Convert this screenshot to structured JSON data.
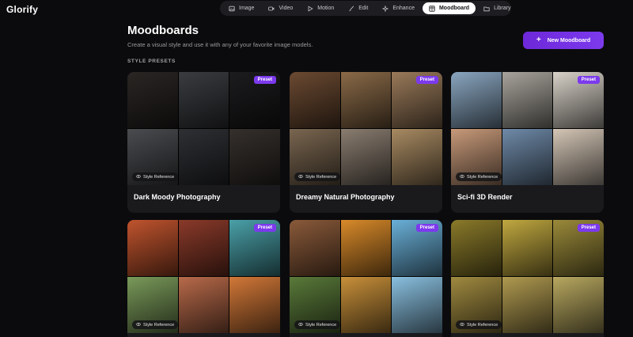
{
  "app": {
    "logo": "Glorify"
  },
  "nav": [
    {
      "label": "Image",
      "icon": "image-icon",
      "active": false
    },
    {
      "label": "Video",
      "icon": "video-icon",
      "active": false
    },
    {
      "label": "Motion",
      "icon": "play-icon",
      "active": false
    },
    {
      "label": "Edit",
      "icon": "brush-icon",
      "active": false
    },
    {
      "label": "Enhance",
      "icon": "sparkle-icon",
      "active": false
    },
    {
      "label": "Moodboard",
      "icon": "grid-icon",
      "active": true
    },
    {
      "label": "Library",
      "icon": "folder-icon",
      "active": false
    }
  ],
  "page": {
    "title": "Moodboards",
    "subtitle": "Create a visual style and use it with any of your favorite image models.",
    "new_button": "New Moodboard",
    "section_label": "STYLE PRESETS"
  },
  "cards": [
    {
      "title": "Dark Moody Photography",
      "badge": "Preset",
      "style_ref": "Style Reference",
      "tiles": [
        "#2a2624",
        "#3a3c40",
        "#1c1c1e",
        "#4a4c50",
        "#2e3034",
        "#35302c"
      ]
    },
    {
      "title": "Dreamy Natural Photography",
      "badge": "Preset",
      "style_ref": "Style Reference",
      "tiles": [
        "#6b4a32",
        "#8a6a48",
        "#9a7a5a",
        "#7a6650",
        "#8a7d70",
        "#a88a62"
      ]
    },
    {
      "title": "Sci-fi 3D Render",
      "badge": "Preset",
      "style_ref": "Style Reference",
      "tiles": [
        "#8aa6c0",
        "#a8a49c",
        "#d8d2c8",
        "#c89a7a",
        "#6f8aa8",
        "#d4c6b6"
      ]
    },
    {
      "title": "",
      "badge": "Preset",
      "style_ref": "Style Reference",
      "tiles": [
        "#c0542e",
        "#8a3a2a",
        "#4aa0a8",
        "#7a9a5a",
        "#b86a4a",
        "#d27838"
      ]
    },
    {
      "title": "",
      "badge": "Preset",
      "style_ref": "Style Reference",
      "tiles": [
        "#8a5a3a",
        "#d88a2a",
        "#6ab0d8",
        "#5a7a3a",
        "#c8903a",
        "#8ac0e0"
      ]
    },
    {
      "title": "",
      "badge": "Preset",
      "style_ref": "Style Reference",
      "tiles": [
        "#8a7a2a",
        "#c0a840",
        "#9a8a3a",
        "#a08a40",
        "#b09a50",
        "#b8a860"
      ]
    }
  ]
}
